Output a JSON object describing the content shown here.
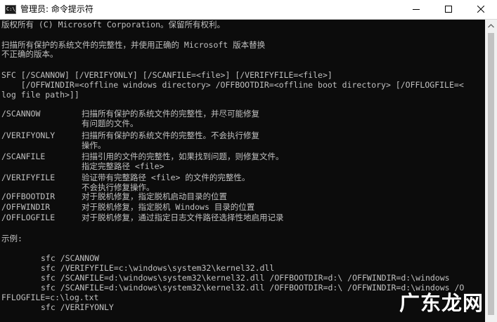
{
  "window": {
    "title": "管理员: 命令提示符",
    "icon": "console-icon",
    "icon_prompt": "C:\\_"
  },
  "console": {
    "copyright": "版权所有 (C) Microsoft Corporation。保留所有权利。",
    "intro": [
      "扫描所有保护的系统文件的完整性，并使用正确的 Microsoft 版本替换",
      "不正确的版本。"
    ],
    "syntax": [
      "SFC [/SCANNOW] [/VERIFYONLY] [/SCANFILE=<file>] [/VERIFYFILE=<file>]",
      "    [/OFFWINDIR=<offline windows directory> /OFFBOOTDIR=<offline boot directory> [/OFFLOGFILE=<",
      "log file path>]]"
    ],
    "options": [
      {
        "name": "/SCANNOW",
        "desc": [
          "扫描所有保护的系统文件的完整性，并尽可能修复",
          "有问题的文件。"
        ]
      },
      {
        "name": "/VERIFYONLY",
        "desc": [
          "扫描所有保护的系统文件的完整性。不会执行修复",
          "操作。"
        ]
      },
      {
        "name": "/SCANFILE",
        "desc": [
          "扫描引用的文件的完整性，如果找到问题，则修复文件。",
          "指定完整路径 <file>"
        ]
      },
      {
        "name": "/VERIFYFILE",
        "desc": [
          "验证带有完整路径 <file> 的文件的完整性。",
          "不会执行修复操作。"
        ]
      },
      {
        "name": "/OFFBOOTDIR",
        "desc": [
          "对于脱机修复，指定脱机启动目录的位置"
        ]
      },
      {
        "name": "/OFFWINDIR",
        "desc": [
          "对于脱机修复，指定脱机 Windows 目录的位置"
        ]
      },
      {
        "name": "/OFFLOGFILE",
        "desc": [
          "对于脱机修复，通过指定日志文件路径选择性地启用记录"
        ]
      }
    ],
    "examples_label": "示例:",
    "examples": [
      "sfc /SCANNOW",
      "sfc /VERIFYFILE=c:\\windows\\system32\\kernel32.dll",
      "sfc /SCANFILE=d:\\windows\\system32\\kernel32.dll /OFFBOOTDIR=d:\\ /OFFWINDIR=d:\\windows",
      "sfc /SCANFILE=d:\\windows\\system32\\kernel32.dll /OFFBOOTDIR=d:\\ /OFFWINDIR=d:\\windows /O"
    ],
    "wrap_line": "FFLOGFILE=c:\\log.txt",
    "last_example": "sfc /VERIFYONLY"
  },
  "watermark": {
    "text": "广东龙网"
  },
  "colors": {
    "console_bg": "#0c0c0c",
    "console_text": "#c0c0c0",
    "titlebar_bg": "#ffffff",
    "scrollbar_bg": "#f0f0f0",
    "scrollbar_thumb": "#c2c2c2"
  }
}
